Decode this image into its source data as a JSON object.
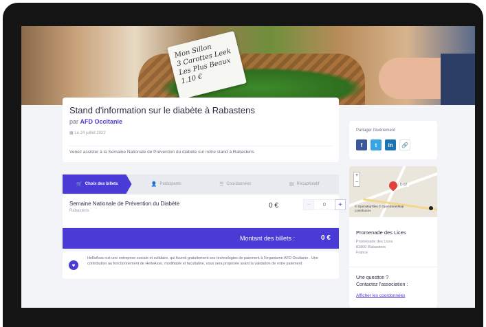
{
  "hero": {
    "sign_lines": [
      "Mon Sillon",
      "3 Carottes Leek",
      "Les Plus Beaux",
      "1.10 €"
    ]
  },
  "event": {
    "title": "Stand d'information sur le diabète à Rabastens",
    "by_prefix": "par",
    "organizer": "AFD Occitanie",
    "date": "Le 24 juillet 2022",
    "description": "Venez assister à la Semaine Nationale de Prévention du diabète sur notre stand à Rabastens"
  },
  "steps": [
    {
      "icon": "cart-icon",
      "glyph": "🛒",
      "label": "Choix des billets",
      "active": true
    },
    {
      "icon": "user-icon",
      "glyph": "👤",
      "label": "Participants",
      "active": false
    },
    {
      "icon": "list-icon",
      "glyph": "☰",
      "label": "Coordonnées",
      "active": false
    },
    {
      "icon": "recap-icon",
      "glyph": "▤",
      "label": "Récapitulatif",
      "active": false
    }
  ],
  "ticket": {
    "name": "Semaine Nationale de Prévention du Diabète",
    "location": "Rabastens",
    "price": "0 €",
    "quantity": "0",
    "minus": "−",
    "plus": "+"
  },
  "total": {
    "label": "Montant des billets :",
    "value": "0 €"
  },
  "helloasso": {
    "text": "HelloAsso est une entreprise sociale et solidaire, qui fournit gratuitement ses technologies de paiement à l'organisme AFD Occitanie . Une contribution au fonctionnement de HelloAsso, modifiable et facultative, vous sera proposée avant la validation de votre paiement."
  },
  "share": {
    "title": "Partager l'événement",
    "buttons": [
      {
        "icon": "facebook-icon",
        "glyph": "f"
      },
      {
        "icon": "twitter-icon",
        "glyph": "t"
      },
      {
        "icon": "linkedin-icon",
        "glyph": "in"
      },
      {
        "icon": "link-icon",
        "glyph": "🔗"
      }
    ]
  },
  "map": {
    "zoom_in": "+",
    "zoom_out": "−",
    "street_label": "D 87",
    "attribution": [
      "© OpenMapTiles © OpenStreetMap",
      "contributors"
    ]
  },
  "venue": {
    "name": "Promenade des Lices",
    "address": [
      "Promenade des Lices",
      "81800 Rabastens",
      "France"
    ]
  },
  "contact": {
    "question_line1": "Une question ?",
    "question_line2": "Contactez l'association :",
    "link": "Afficher les coordonnées"
  },
  "colors": {
    "accent": "#4a3ad6",
    "background": "#f3f4f8",
    "device": "#141414"
  }
}
